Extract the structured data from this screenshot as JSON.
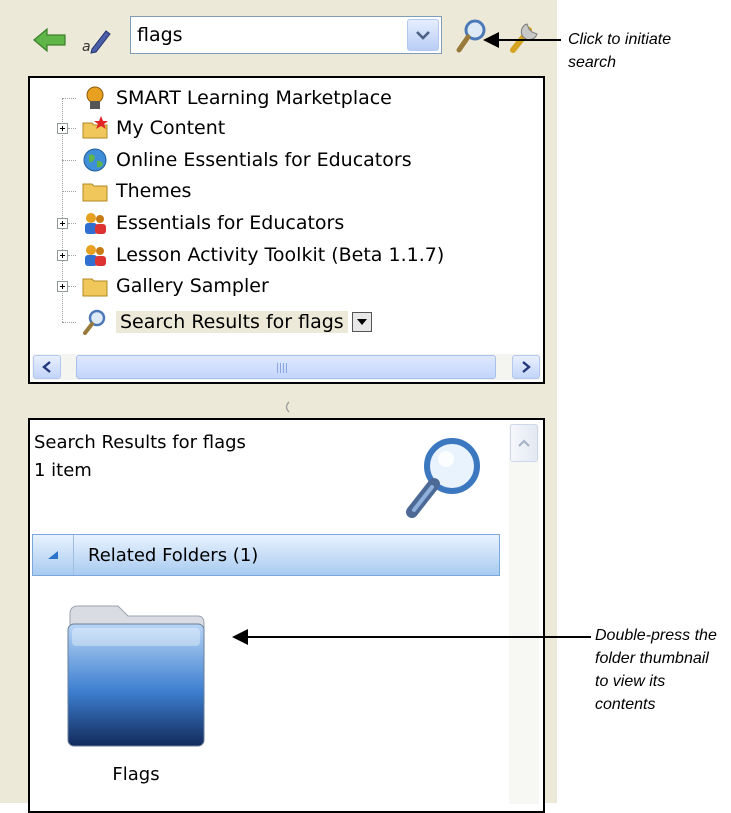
{
  "toolbar": {
    "search_value": "flags",
    "icons": {
      "back": "back-arrow-icon",
      "rename": "pencil-icon",
      "search": "magnifier-icon",
      "tools": "tools-icon"
    }
  },
  "tree": {
    "items": [
      {
        "label": "SMART Learning Marketplace",
        "icon": "marketplace-icon",
        "expandable": false
      },
      {
        "label": "My Content",
        "icon": "folder-star-icon",
        "expandable": true
      },
      {
        "label": "Online Essentials for Educators",
        "icon": "globe-icon",
        "expandable": false
      },
      {
        "label": "Themes",
        "icon": "folder-icon",
        "expandable": false
      },
      {
        "label": "Essentials for Educators",
        "icon": "people-icon",
        "expandable": true
      },
      {
        "label": "Lesson Activity Toolkit (Beta 1.1.7)",
        "icon": "people-icon",
        "expandable": true
      },
      {
        "label": "Gallery Sampler",
        "icon": "folder-icon",
        "expandable": true
      },
      {
        "label": "Search Results for flags",
        "icon": "search-icon",
        "expandable": false,
        "selected": true
      }
    ]
  },
  "results": {
    "title": "Search Results for flags",
    "count": "1 item",
    "section_label": "Related Folders (1)",
    "folder_label": "Flags"
  },
  "callouts": {
    "search": "Click to initiate search",
    "folder": "Double-press the folder thumbnail to view its contents"
  }
}
